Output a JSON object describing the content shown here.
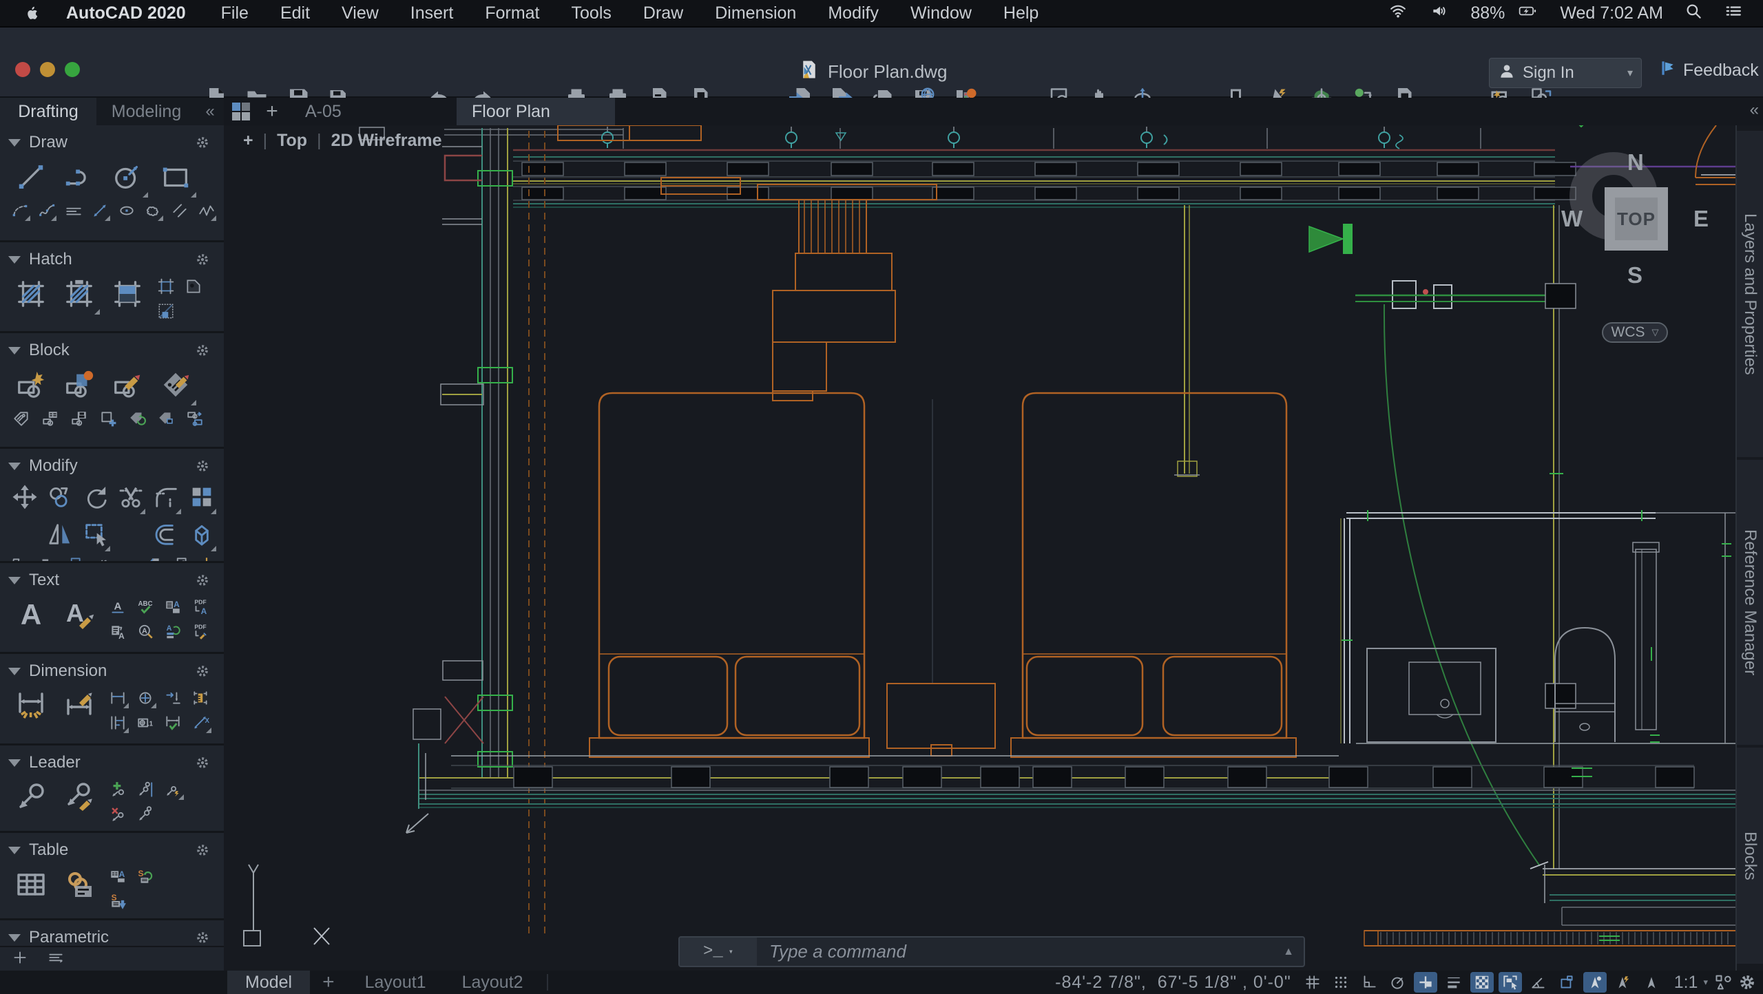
{
  "menubar": {
    "app_name": "AutoCAD 2020",
    "items": [
      "File",
      "Edit",
      "View",
      "Insert",
      "Format",
      "Tools",
      "Draw",
      "Dimension",
      "Modify",
      "Window",
      "Help"
    ],
    "status": {
      "battery": "88%",
      "clock": "Wed 7:02 AM"
    },
    "status_icons": [
      "wifi-icon",
      "volume-icon",
      "battery-charging-icon",
      "search-icon",
      "control-center-icon"
    ]
  },
  "titlebar": {
    "document": "Floor Plan.dwg",
    "sign_in": "Sign In",
    "feedback": "Feedback"
  },
  "toolbar": {
    "groups": [
      [
        "new-file",
        "open-file",
        "save",
        "save-as"
      ],
      [
        "undo",
        "redo"
      ],
      [
        "print",
        "batch-plot",
        "page-setup",
        "plot-edit"
      ],
      [
        "import",
        "export",
        "attach-reference",
        "save-to-web",
        "xref-compare"
      ],
      [
        "zoom-window",
        "pan",
        "orbit"
      ],
      [
        "tool-sets",
        "quick-select",
        "geolocation",
        "object-color",
        "purge"
      ],
      [
        "render",
        "render-region"
      ]
    ]
  },
  "palette": {
    "tabs": [
      {
        "label": "Drafting",
        "active": true
      },
      {
        "label": "Modeling",
        "active": false
      }
    ],
    "collapse": "«",
    "sections": [
      {
        "label": "Draw",
        "rows": [
          {
            "type": "icons",
            "size": "lg",
            "icons": [
              "line",
              "arc",
              "circle",
              "rectangle"
            ]
          },
          {
            "type": "icons",
            "size": "sm",
            "icons": [
              "arc-small",
              "spline",
              "multiline",
              "measure",
              "ellipse",
              "revision-cloud",
              "break",
              "polyline"
            ]
          }
        ]
      },
      {
        "label": "Hatch",
        "rows": [
          {
            "type": "hatch",
            "lg": [
              "hatch-pattern",
              "hatch-annotative",
              "gradient"
            ],
            "cluster": [
              "boundary",
              "hatch-tool",
              "hatch-edit"
            ]
          }
        ]
      },
      {
        "label": "Block",
        "rows": [
          {
            "type": "icons",
            "size": "lg",
            "icons": [
              "block-create",
              "block-insert",
              "block-edit",
              "attribute-edit"
            ]
          },
          {
            "type": "icons",
            "size": "sm",
            "icons": [
              "attribute-tag",
              "block-attribute-manager",
              "block-save",
              "block-add",
              "attribute-sync",
              "attribute-block",
              "block-replace"
            ]
          }
        ]
      },
      {
        "label": "Modify",
        "rows": [
          {
            "type": "icons",
            "size": "md",
            "icons": [
              "move",
              "copy",
              "rotate",
              "trim",
              "fillet",
              "array"
            ]
          },
          {
            "type": "icons",
            "size": "md",
            "icons": [
              "spacer",
              "mirror",
              "select",
              "spacer",
              "offset",
              "extrude"
            ]
          },
          {
            "type": "icons",
            "size": "sm",
            "icons": [
              "stretch",
              "copy-nested",
              "scale",
              "break-line",
              "join",
              "align",
              "overlay",
              "point"
            ]
          }
        ]
      },
      {
        "label": "Text",
        "rows": [
          {
            "type": "mixed",
            "lg": [
              "mtext",
              "text-style"
            ],
            "cols": 4,
            "grid": [
              "text-underline",
              "spell-check",
              "text-columns",
              "pdf-import-text",
              "text-field",
              "text-find",
              "text-align",
              "pdf-text-edit"
            ]
          }
        ]
      },
      {
        "label": "Dimension",
        "rows": [
          {
            "type": "mixed",
            "lg": [
              "dimension-linear",
              "dimension-style"
            ],
            "cols": 4,
            "grid": [
              "dim-aligned",
              "center-mark",
              "dim-ordinate",
              "dim-ruler",
              "dim-baseline",
              "dim-tolerance",
              "dim-check",
              "dim-measure"
            ]
          }
        ]
      },
      {
        "label": "Leader",
        "rows": [
          {
            "type": "mixed",
            "lg": [
              "multileader",
              "multileader-style"
            ],
            "cols": 3,
            "grid": [
              "leader-add",
              "leader-align",
              "leader-collect",
              "leader-remove",
              "leader-merge"
            ]
          }
        ]
      },
      {
        "label": "Table",
        "rows": [
          {
            "type": "mixed",
            "lg": [
              "table",
              "data-link"
            ],
            "cols": 2,
            "grid": [
              "table-text",
              "table-sync",
              "table-export"
            ]
          }
        ]
      },
      {
        "label": "Parametric",
        "rows": [
          {
            "type": "icons",
            "size": "md",
            "icons": [
              "constraint-bar",
              "auto-constrain",
              "infer-constraints",
              "dim-constraint",
              "constraint-sync",
              "constraint-show"
            ]
          }
        ]
      }
    ],
    "footer_icons": [
      "add-palette",
      "palette-menu"
    ]
  },
  "canvas": {
    "file_tabs": {
      "add": "+",
      "tabs": [
        {
          "label": "A-05",
          "active": false
        },
        {
          "label": "Floor Plan",
          "active": true
        }
      ]
    },
    "viewport_controls": {
      "add": "+",
      "view": "Top",
      "style": "2D Wireframe"
    },
    "viewcube": {
      "north": "N",
      "south": "S",
      "east": "E",
      "west": "W",
      "face": "TOP",
      "ucs": "WCS"
    },
    "side_tabs": [
      "Layers and Properties",
      "Reference Manager",
      "Blocks"
    ],
    "collapse": "«",
    "command": {
      "prompt": ">_",
      "placeholder": "Type a command"
    }
  },
  "statusbar": {
    "layout_tabs": [
      "Model",
      "+",
      "Layout1",
      "Layout2"
    ],
    "active_tab": "Model",
    "coordinates": "-84'-2 7/8\",  67'-5 1/8\" , 0'-0\"",
    "scale": "1:1",
    "icons": [
      {
        "name": "grid",
        "active": false
      },
      {
        "name": "snap",
        "active": false
      },
      {
        "name": "ortho",
        "active": false
      },
      {
        "name": "polar-tracking",
        "active": false
      },
      {
        "name": "object-snap",
        "active": true
      },
      {
        "name": "lineweight",
        "active": false
      },
      {
        "name": "transparency",
        "active": true
      },
      {
        "name": "selection-cycling",
        "active": true
      },
      {
        "name": "angle-snap",
        "active": false
      },
      {
        "name": "dynamic-ucs",
        "active": false
      },
      {
        "name": "annotation-visibility",
        "active": true
      },
      {
        "name": "annotation-auto-scale",
        "active": false
      },
      {
        "name": "annotation-scale",
        "active": false
      }
    ]
  },
  "drawing": {
    "colors": {
      "canvas_bg": "#171a20",
      "wall_orange": "#b06224",
      "dashed_orange": "#7a4a1e",
      "teal": "#2f6f63",
      "bright_green": "#35b04a",
      "olive_yellow": "#9fa040",
      "dark_red": "#8d4545",
      "cyan": "#3fa0a0",
      "magenta": "#5f3d8f",
      "fixture_gray": "#8a9098"
    }
  }
}
